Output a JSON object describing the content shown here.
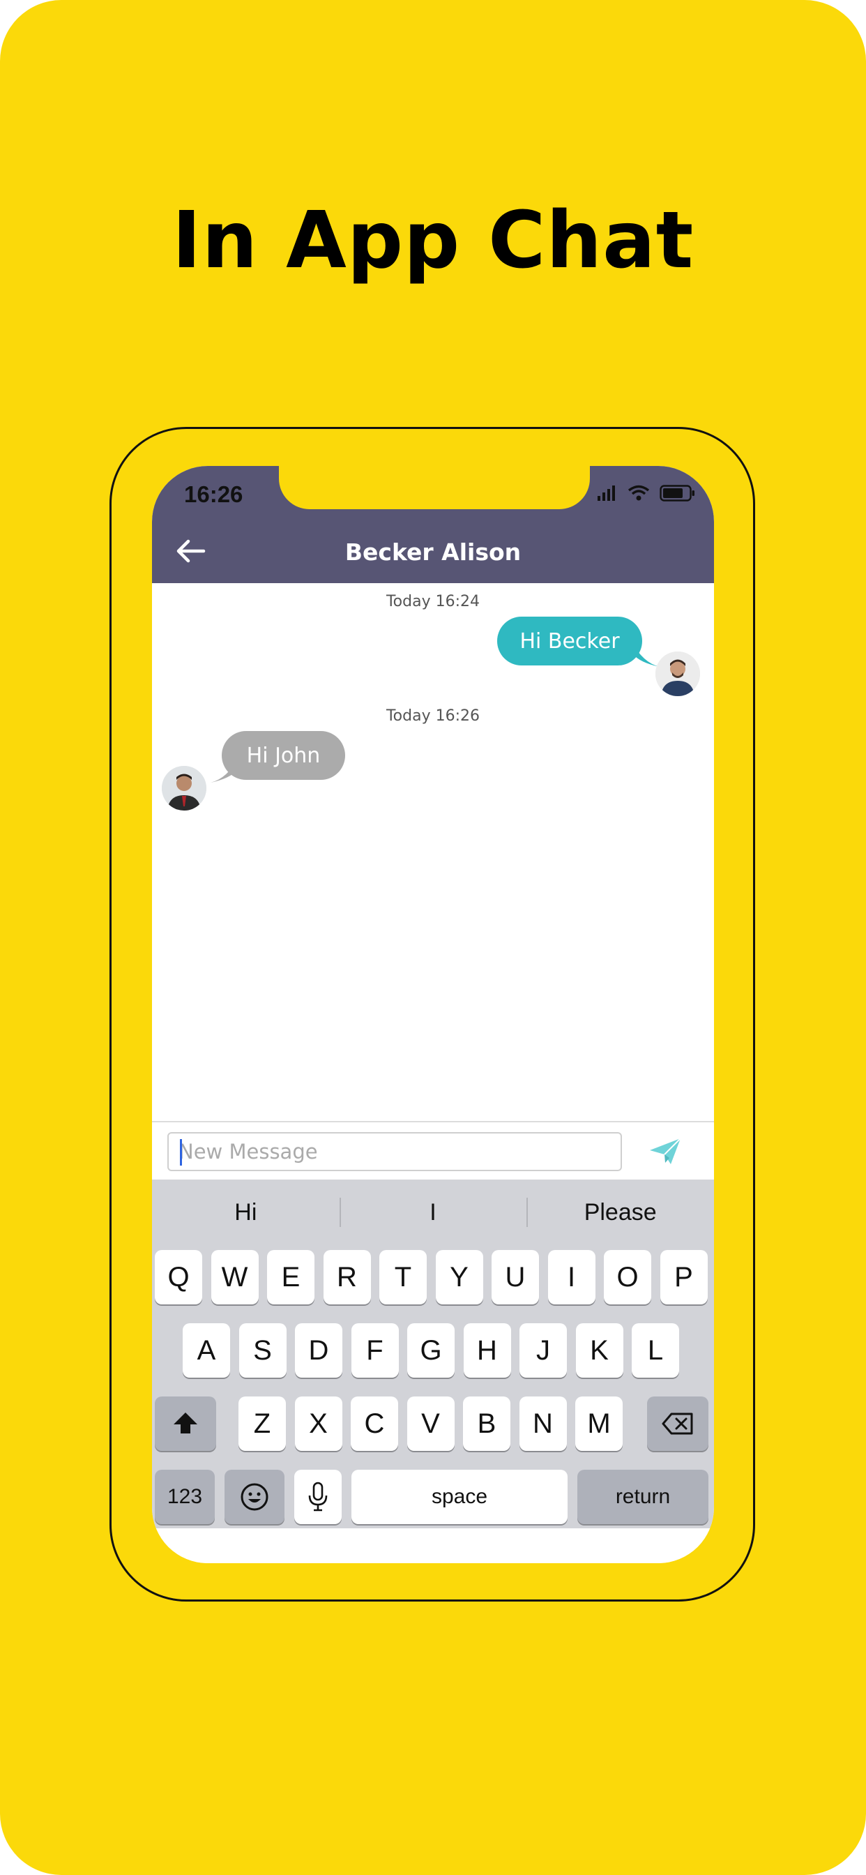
{
  "headline": "In App Chat",
  "status_bar": {
    "time": "16:26"
  },
  "header": {
    "title": "Becker Alison",
    "back_icon": "arrow-left-icon"
  },
  "messages": [
    {
      "timestamp": "Today 16:24",
      "text": "Hi Becker",
      "direction": "outgoing"
    },
    {
      "timestamp": "Today 16:26",
      "text": "Hi John",
      "direction": "incoming"
    }
  ],
  "composer": {
    "placeholder": "New Message",
    "value": "",
    "send_icon": "paper-plane-icon"
  },
  "keyboard": {
    "suggestions": [
      "Hi",
      "I",
      "Please"
    ],
    "row1": [
      "Q",
      "W",
      "E",
      "R",
      "T",
      "Y",
      "U",
      "I",
      "O",
      "P"
    ],
    "row2": [
      "A",
      "S",
      "D",
      "F",
      "G",
      "H",
      "J",
      "K",
      "L"
    ],
    "row3": [
      "Z",
      "X",
      "C",
      "V",
      "B",
      "N",
      "M"
    ],
    "numbers_label": "123",
    "space_label": "space",
    "return_label": "return"
  },
  "colors": {
    "background": "#FBD90A",
    "header": "#575574",
    "outgoing_bubble": "#2FB9C1",
    "incoming_bubble": "#ABABAB",
    "keyboard": "#D2D3D8",
    "send_icon": "#6FD3D8"
  }
}
